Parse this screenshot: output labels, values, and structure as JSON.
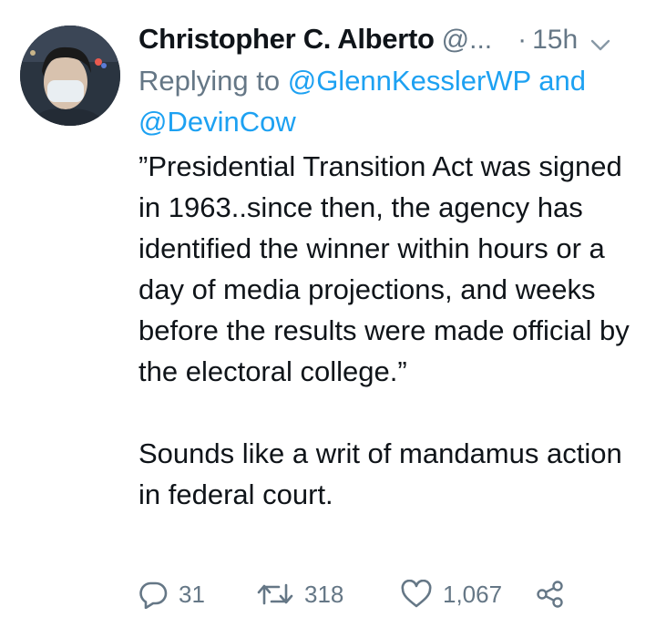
{
  "tweet": {
    "author_name": "Christopher C. Alberto",
    "handle": "@...",
    "separator": "·",
    "time": "15h",
    "reply_prefix": "Replying to ",
    "reply_mention_1": "@GlennKesslerWP",
    "reply_and": " and",
    "reply_mention_2": "@DevinCow",
    "body": "”Presidential Transition Act was signed in 1963..since then, the agency has identified the winner within hours or a day of media projections, and weeks before the results were made official by the electoral college.”\n\nSounds like a writ of mandamus action in federal court.",
    "icons": {
      "avatar": "profile-photo",
      "menu": "chevron-down-icon",
      "reply": "reply-icon",
      "retweet": "retweet-icon",
      "like": "heart-icon",
      "share": "share-icon"
    }
  },
  "actions": {
    "reply_count": "31",
    "retweet_count": "318",
    "like_count": "1,067"
  },
  "colors": {
    "accent": "#1da1f2",
    "secondary_text": "#657786",
    "primary_text": "#0f1419"
  }
}
